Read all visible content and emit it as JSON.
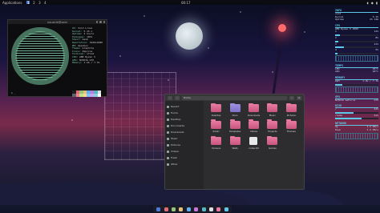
{
  "top_panel": {
    "apps_label": "Applications",
    "workspaces": [
      "1",
      "2",
      "3",
      "4"
    ],
    "clock": "00:17",
    "tray": [
      "vol",
      "net",
      "bat"
    ]
  },
  "terminal": {
    "title": "kaushik@void",
    "sysinfo": [
      {
        "k": "OS:",
        "v": "Void Linux"
      },
      {
        "k": "Kernel:",
        "v": "5.15.x"
      },
      {
        "k": "Uptime:",
        "v": "2 hours"
      },
      {
        "k": "Packages:",
        "v": "1031"
      },
      {
        "k": "Shell:",
        "v": "bash"
      },
      {
        "k": "Resolution:",
        "v": "1920x1080"
      },
      {
        "k": "WM:",
        "v": "Openbox"
      },
      {
        "k": "Theme:",
        "v": "Graphite"
      },
      {
        "k": "Icons:",
        "v": "Papirus"
      },
      {
        "k": "Terminal:",
        "v": "xfce4"
      },
      {
        "k": "CPU:",
        "v": "AMD Ryzen 5"
      },
      {
        "k": "GPU:",
        "v": "NVIDIA GTX"
      },
      {
        "k": "Memory:",
        "v": "1.2G / 7.7G"
      }
    ],
    "palette": [
      "#1d1d1d",
      "#e06c75",
      "#98c379",
      "#e5c07b",
      "#61afef",
      "#c678dd",
      "#56b6c2",
      "#dcdfe4",
      "#5c6370",
      "#ff7b86",
      "#b5e890",
      "#ffd68a",
      "#7cc4ff",
      "#dd9cf0",
      "#7fd6e0",
      "#ffffff"
    ],
    "prompt": "$ _"
  },
  "file_manager": {
    "path": "Home",
    "sidebar": [
      "Recent",
      "Home",
      "Desktop",
      "Documents",
      "Downloads",
      "Music",
      "Pictures",
      "Videos",
      "Trash",
      "Other"
    ],
    "items": [
      {
        "label": "Desktop",
        "kind": "folder"
      },
      {
        "label": "Docs",
        "kind": "alt"
      },
      {
        "label": "Downloads",
        "kind": "folder"
      },
      {
        "label": "Music",
        "kind": "folder"
      },
      {
        "label": "Pictures",
        "kind": "folder"
      },
      {
        "label": "Public",
        "kind": "folder"
      },
      {
        "label": "Templates",
        "kind": "folder"
      },
      {
        "label": "Videos",
        "kind": "folder"
      },
      {
        "label": "Projects",
        "kind": "folder"
      },
      {
        "label": "Themes",
        "kind": "folder"
      },
      {
        "label": "Screens",
        "kind": "folder"
      },
      {
        "label": "Walls",
        "kind": "folder"
      },
      {
        "label": "notes.txt",
        "kind": "file"
      },
      {
        "label": "Games",
        "kind": "folder"
      }
    ]
  },
  "conky": {
    "title": "INFO",
    "host": "void",
    "info_rows": [
      {
        "k": "Kernel",
        "v": "5.15"
      },
      {
        "k": "Uptime",
        "v": "2h 14m"
      }
    ],
    "cpu_title": "CPU",
    "cpu_model": "AMD Ryzen 5 3600",
    "cpu_cores": [
      {
        "k": "1",
        "v": "12%",
        "level": 0.12
      },
      {
        "k": "2",
        "v": "8%",
        "level": 0.08
      },
      {
        "k": "3",
        "v": "21%",
        "level": 0.21
      },
      {
        "k": "4",
        "v": "5%",
        "level": 0.05
      }
    ],
    "temp_title": "TEMPS",
    "temps": [
      {
        "k": "CPU",
        "v": "45°C"
      },
      {
        "k": "GPU",
        "v": "40°C"
      }
    ],
    "mem_title": "MEMORY",
    "mem": {
      "k": "RAM",
      "v": "1.2G / 7.7G",
      "level": 0.16
    },
    "gpu_title": "GPU",
    "gpu": {
      "k": "NVIDIA GeForce",
      "v": "GTX"
    },
    "disk_title": "DISK",
    "disks": [
      {
        "k": "/",
        "v": "42%",
        "level": 0.42
      },
      {
        "k": "/home",
        "v": "61%",
        "level": 0.61
      }
    ],
    "net_title": "NETWORK",
    "net": [
      {
        "k": "Up",
        "v": "1.2 KB/s"
      },
      {
        "k": "Down",
        "v": "3.4 KB/s"
      }
    ]
  },
  "dock_colors": [
    "#4a7bd8",
    "#e06c75",
    "#98c379",
    "#e5c07b",
    "#61afef",
    "#c678dd",
    "#56b6c2",
    "#dcdfe4",
    "#e87a9f",
    "#5ec8e8"
  ],
  "accent": "#5ec8e8"
}
